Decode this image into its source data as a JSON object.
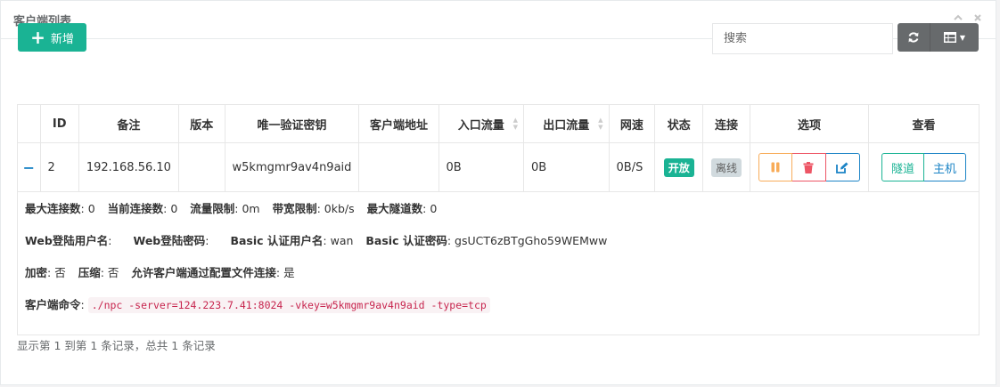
{
  "panel": {
    "title": "客户端列表"
  },
  "toolbar": {
    "add_label": "新增",
    "search_placeholder": "搜索"
  },
  "table": {
    "headers": [
      "",
      "ID",
      "备注",
      "版本",
      "唯一验证密钥",
      "客户端地址",
      "入口流量",
      "出口流量",
      "网速",
      "状态",
      "连接",
      "选项",
      "查看"
    ],
    "row": {
      "id": "2",
      "remark": "192.168.56.10",
      "version": "",
      "vkey": "w5kmgmr9av4n9aid",
      "address": "",
      "inflow": "0B",
      "outflow": "0B",
      "speed": "0B/S",
      "status": "开放",
      "connection": "离线",
      "view_tunnel": "隧道",
      "view_host": "主机"
    },
    "detail": {
      "max_conn_label": "最大连接数",
      "max_conn": ": 0",
      "cur_conn_label": "当前连接数",
      "cur_conn": ": 0",
      "flow_limit_label": "流量限制",
      "flow_limit": ": 0m",
      "rate_limit_label": "带宽限制",
      "rate_limit": ": 0kb/s",
      "max_tunnel_label": "最大隧道数",
      "max_tunnel": ": 0",
      "web_user_label": "Web登陆用户名",
      "web_user": ":",
      "web_pass_label": "Web登陆密码",
      "web_pass": ":",
      "basic_user_label": "Basic 认证用户名",
      "basic_user": ": wan",
      "basic_pass_label": "Basic 认证密码",
      "basic_pass": ": gsUCT6zBTgGho59WEMww",
      "crypt_label": "加密",
      "crypt": ": 否",
      "compress_label": "压缩",
      "compress": ": 否",
      "config_conn_label": "允许客户端通过配置文件连接",
      "config_conn": ": 是",
      "cmd_label": "客户端命令",
      "cmd_colon": ":",
      "cmd": "./npc -server=124.223.7.41:8024 -vkey=w5kmgmr9av4n9aid -type=tcp"
    }
  },
  "pagination": {
    "info": "显示第 1 到第 1 条记录，总共 1 条记录"
  },
  "colors": {
    "primary": "#1ab394",
    "info": "#1c84c6",
    "warning": "#f8ac59",
    "danger": "#ed5565",
    "gray_btn": "#676a6c"
  }
}
